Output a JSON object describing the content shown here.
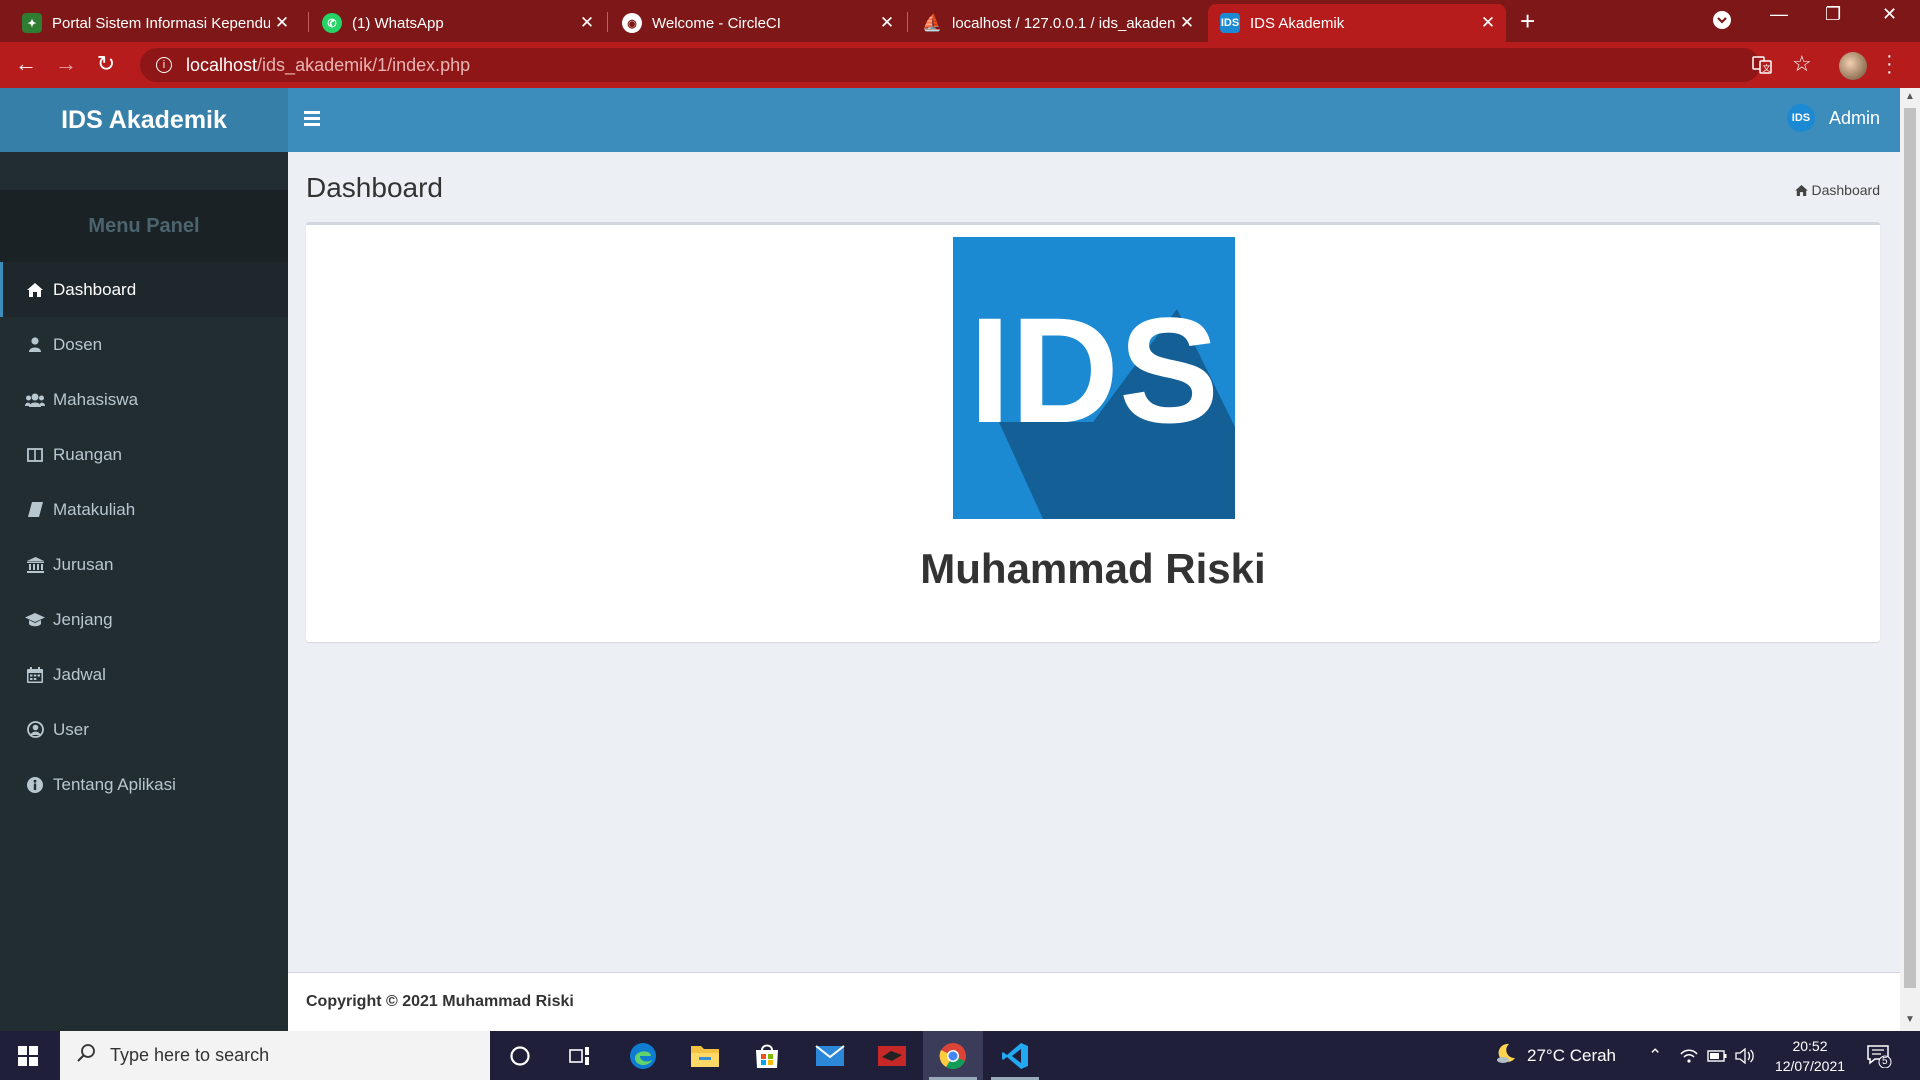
{
  "browser": {
    "tabs": [
      {
        "title": "Portal Sistem Informasi Kependu",
        "icon": "portal-favicon",
        "color": "#2e7d32"
      },
      {
        "title": "(1) WhatsApp",
        "icon": "whatsapp-favicon",
        "color": "#25d366"
      },
      {
        "title": "Welcome - CircleCI",
        "icon": "circleci-favicon",
        "color": "#ffffff"
      },
      {
        "title": "localhost / 127.0.0.1 / ids_akaden",
        "icon": "phpmyadmin-favicon",
        "color": "#f29111"
      },
      {
        "title": "IDS Akademik",
        "icon": "ids-favicon",
        "color": "#1b8ad3",
        "active": true
      }
    ],
    "url_host": "localhost",
    "url_path": "/ids_akademik/1/index.php"
  },
  "app": {
    "brand": "IDS Akademik",
    "user": "Admin",
    "avatar_text": "IDS",
    "menu_header": "Menu Panel",
    "menu": [
      {
        "label": "Dashboard",
        "icon": "home-icon",
        "active": true
      },
      {
        "label": "Dosen",
        "icon": "user-icon"
      },
      {
        "label": "Mahasiswa",
        "icon": "users-icon"
      },
      {
        "label": "Ruangan",
        "icon": "columns-icon"
      },
      {
        "label": "Matakuliah",
        "icon": "book-icon"
      },
      {
        "label": "Jurusan",
        "icon": "institution-icon"
      },
      {
        "label": "Jenjang",
        "icon": "graduation-cap-icon"
      },
      {
        "label": "Jadwal",
        "icon": "calendar-icon"
      },
      {
        "label": "User",
        "icon": "user-circle-icon"
      },
      {
        "label": "Tentang Aplikasi",
        "icon": "info-circle-icon"
      }
    ],
    "page_title": "Dashboard",
    "breadcrumb": "Dashboard",
    "logo_text": "IDS",
    "owner_name": "Muhammad Riski",
    "footer": "Copyright © 2021 Muhammad Riski",
    "colors": {
      "header": "#3c8dbc",
      "brand": "#367fa9",
      "sidebar": "#222d32",
      "logo_bg": "#1b8ad3"
    }
  },
  "taskbar": {
    "search_placeholder": "Type here to search",
    "weather": "27°C  Cerah",
    "time": "20:52",
    "date": "12/07/2021",
    "notifications": "5"
  }
}
